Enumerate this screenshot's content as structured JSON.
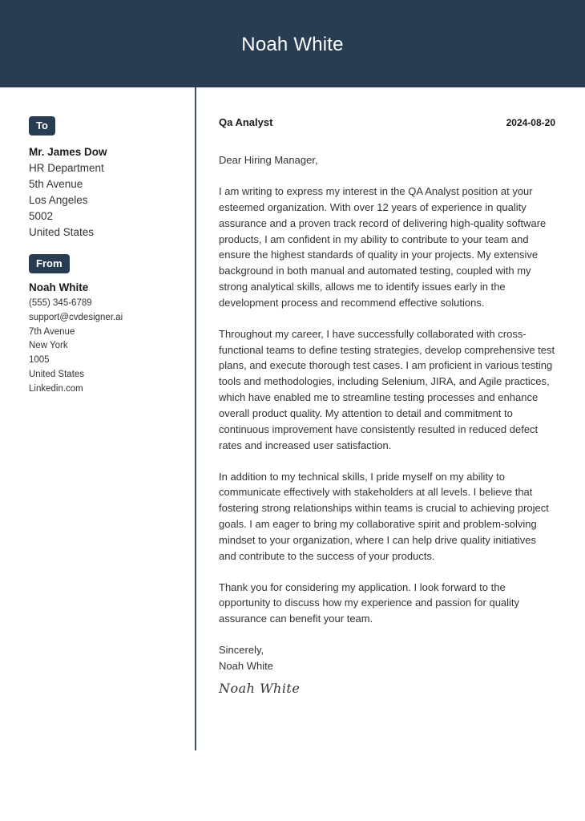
{
  "header": {
    "name": "Noah White"
  },
  "recipient": {
    "badge": "To",
    "name": "Mr. James Dow",
    "lines": [
      "HR Department",
      "5th Avenue",
      "Los Angeles",
      "5002",
      "United States"
    ]
  },
  "sender": {
    "badge": "From",
    "name": "Noah White",
    "lines": [
      "(555) 345-6789",
      "support@cvdesigner.ai",
      "7th Avenue",
      "New York",
      "1005",
      "United States",
      "Linkedin.com"
    ]
  },
  "letter": {
    "job_title": "Qa Analyst",
    "date": "2024-08-20",
    "salutation": "Dear Hiring Manager,",
    "paragraphs": [
      "I am writing to express my interest in the QA Analyst position at your esteemed organization. With over 12 years of experience in quality assurance and a proven track record of delivering high-quality software products, I am confident in my ability to contribute to your team and ensure the highest standards of quality in your projects. My extensive background in both manual and automated testing, coupled with my strong analytical skills, allows me to identify issues early in the development process and recommend effective solutions.",
      "Throughout my career, I have successfully collaborated with cross-functional teams to define testing strategies, develop comprehensive test plans, and execute thorough test cases. I am proficient in various testing tools and methodologies, including Selenium, JIRA, and Agile practices, which have enabled me to streamline testing processes and enhance overall product quality. My attention to detail and commitment to continuous improvement have consistently resulted in reduced defect rates and increased user satisfaction.",
      "In addition to my technical skills, I pride myself on my ability to communicate effectively with stakeholders at all levels. I believe that fostering strong relationships within teams is crucial to achieving project goals. I am eager to bring my collaborative spirit and problem-solving mindset to your organization, where I can help drive quality initiatives and contribute to the success of your products.",
      "Thank you for considering my application. I look forward to the opportunity to discuss how my experience and passion for quality assurance can benefit your team."
    ],
    "closing": "Sincerely,",
    "closing_name": "Noah White",
    "signature": "Noah White"
  }
}
